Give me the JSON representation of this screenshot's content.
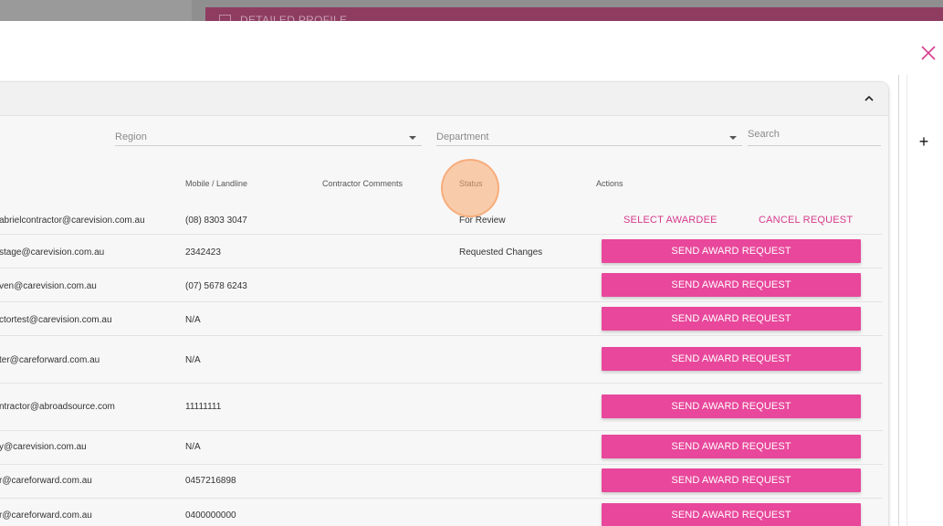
{
  "background": {
    "bar_label": "DETAILED PROFILE"
  },
  "filters": {
    "region_label": "Region",
    "department_label": "Department",
    "search_placeholder": "Search"
  },
  "table": {
    "headers": {
      "mobile": "Mobile / Landline",
      "comments": "Contractor Comments",
      "status": "Status",
      "actions": "Actions"
    },
    "rows": [
      {
        "email": "abrielcontractor@carevision.com.au",
        "mobile": "(08) 8303 3047",
        "status": "For Review",
        "action_primary": "SELECT AWARDEE",
        "action_secondary": "CANCEL REQUEST"
      },
      {
        "email": "stage@carevision.com.au",
        "mobile": "2342423",
        "status": "Requested Changes",
        "action": "SEND AWARD REQUEST"
      },
      {
        "email": "ven@carevision.com.au",
        "mobile": "(07) 5678 6243",
        "status": "",
        "action": "SEND AWARD REQUEST"
      },
      {
        "email": "ctortest@carevision.com.au",
        "mobile": "N/A",
        "status": "",
        "action": "SEND AWARD REQUEST"
      },
      {
        "email": "ter@careforward.com.au",
        "mobile": "N/A",
        "status": "",
        "action": "SEND AWARD REQUEST"
      },
      {
        "email": "ntractor@abroadsource.com",
        "mobile": "11111111",
        "status": "",
        "action": "SEND AWARD REQUEST"
      },
      {
        "email": "y@carevision.com.au",
        "mobile": "N/A",
        "status": "",
        "action": "SEND AWARD REQUEST"
      },
      {
        "email": "r@careforward.com.au",
        "mobile": "0457216898",
        "status": "",
        "action": "SEND AWARD REQUEST"
      },
      {
        "email": "r@careforward.com.au",
        "mobile": "0400000000",
        "status": "",
        "action": "SEND AWARD REQUEST"
      }
    ]
  },
  "colors": {
    "accent": "#e8479b",
    "link": "#d63a8c",
    "background_bar": "#8e3d61"
  },
  "icons": {
    "close": "close-icon",
    "add": "plus-icon",
    "collapse": "chevron-up-icon"
  }
}
